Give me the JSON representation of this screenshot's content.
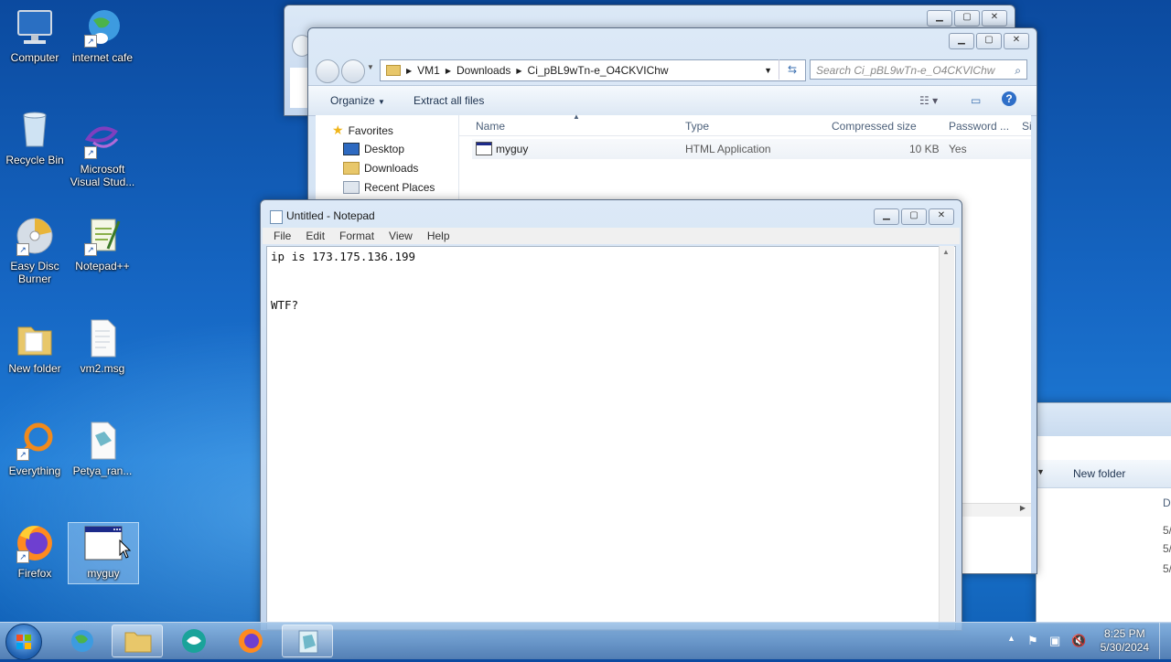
{
  "desktop": {
    "icons": [
      {
        "label": "Computer"
      },
      {
        "label": "internet cafe"
      },
      {
        "label": "Recycle Bin"
      },
      {
        "label": "Microsoft Visual Stud..."
      },
      {
        "label": "Easy Disc Burner"
      },
      {
        "label": "Notepad++"
      },
      {
        "label": "New folder"
      },
      {
        "label": "vm2.msg"
      },
      {
        "label": "Everything"
      },
      {
        "label": "Petya_ran..."
      },
      {
        "label": "Firefox"
      },
      {
        "label": "myguy"
      }
    ]
  },
  "explorer": {
    "breadcrumb": [
      "VM1",
      "Downloads",
      "Ci_pBL9wTn-e_O4CKVIChw"
    ],
    "search_placeholder": "Search Ci_pBL9wTn-e_O4CKVIChw",
    "toolbar": {
      "organize": "Organize",
      "extract": "Extract all files"
    },
    "nav": {
      "favorites": "Favorites",
      "items": [
        "Desktop",
        "Downloads",
        "Recent Places"
      ]
    },
    "columns": [
      "Name",
      "Type",
      "Compressed size",
      "Password ...",
      "Si"
    ],
    "files": [
      {
        "name": "myguy",
        "type": "HTML Application",
        "size": "10 KB",
        "password": "Yes"
      }
    ]
  },
  "background_window": {
    "new_folder": "New folder",
    "col_d": "D",
    "dates": [
      "5/",
      "5/",
      "5/"
    ]
  },
  "notepad": {
    "title": "Untitled - Notepad",
    "menu": [
      "File",
      "Edit",
      "Format",
      "View",
      "Help"
    ],
    "content": "ip is 173.175.136.199\n\n\nWTF?"
  },
  "taskbar": {
    "time": "8:25 PM",
    "date": "5/30/2024"
  }
}
